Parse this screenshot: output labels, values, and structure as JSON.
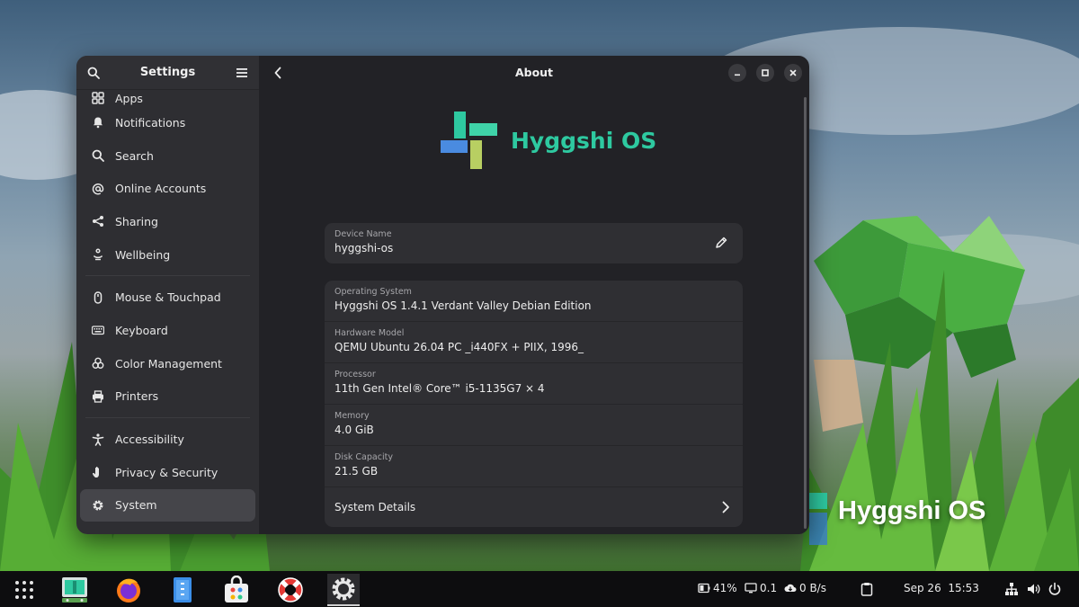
{
  "window": {
    "sidebar_title": "Settings",
    "page_title": "About"
  },
  "sidebar": {
    "groups": [
      [
        {
          "label": "Apps",
          "icon": "apps-icon"
        },
        {
          "label": "Notifications",
          "icon": "bell-icon"
        },
        {
          "label": "Search",
          "icon": "search-icon"
        },
        {
          "label": "Online Accounts",
          "icon": "at-icon"
        },
        {
          "label": "Sharing",
          "icon": "share-icon"
        },
        {
          "label": "Wellbeing",
          "icon": "wellbeing-icon"
        }
      ],
      [
        {
          "label": "Mouse & Touchpad",
          "icon": "mouse-icon"
        },
        {
          "label": "Keyboard",
          "icon": "keyboard-icon"
        },
        {
          "label": "Color Management",
          "icon": "palette-icon"
        },
        {
          "label": "Printers",
          "icon": "printer-icon"
        }
      ],
      [
        {
          "label": "Accessibility",
          "icon": "accessibility-icon"
        },
        {
          "label": "Privacy & Security",
          "icon": "hand-icon"
        },
        {
          "label": "System",
          "icon": "gear-icon",
          "active": true
        }
      ]
    ]
  },
  "about": {
    "os_brand": "Hyggshi OS",
    "device_name_label": "Device Name",
    "device_name": "hyggshi-os",
    "rows": [
      {
        "label": "Operating System",
        "value": "Hyggshi OS 1.4.1 Verdant Valley Debian Edition"
      },
      {
        "label": "Hardware Model",
        "value": "QEMU Ubuntu 26.04 PC _i440FX + PIIX, 1996_"
      },
      {
        "label": "Processor",
        "value": "11th Gen Intel® Core™ i5-1135G7 × 4"
      },
      {
        "label": "Memory",
        "value": "4.0 GiB"
      },
      {
        "label": "Disk Capacity",
        "value": "21.5 GB"
      }
    ],
    "system_details_label": "System Details"
  },
  "wallpaper": {
    "brand_text": "Hyggshi OS"
  },
  "taskbar": {
    "battery": "41%",
    "cpu": "0.1",
    "network": "0 B/s",
    "date": "Sep 26",
    "time": "15:53"
  },
  "colors": {
    "accent_teal": "#2ec9a0",
    "window_bg": "#222226",
    "sidebar_bg": "#2e2e32",
    "card_bg": "#2f2f33"
  }
}
